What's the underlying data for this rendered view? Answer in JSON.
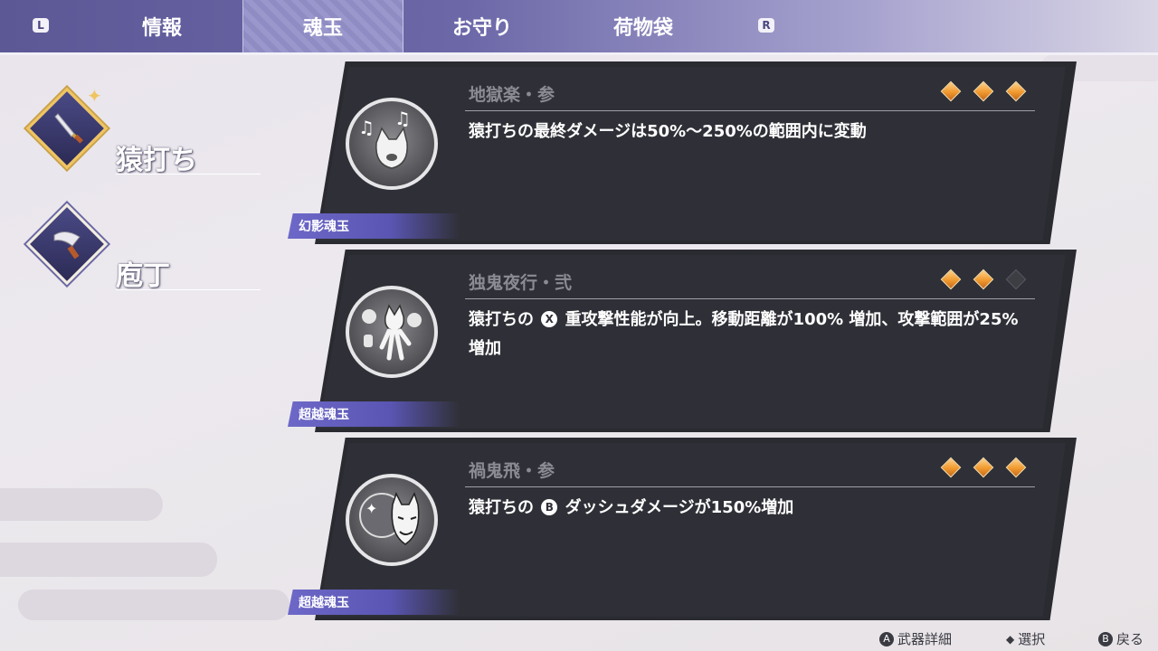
{
  "top_bar": {
    "left_key": "L",
    "right_key": "R",
    "tabs": [
      {
        "label": "情報",
        "active": false
      },
      {
        "label": "魂玉",
        "active": true
      },
      {
        "label": "お守り",
        "active": false
      },
      {
        "label": "荷物袋",
        "active": false
      }
    ]
  },
  "weapons": [
    {
      "name": "猿打ち",
      "icon": "katana-icon",
      "selected": true
    },
    {
      "name": "庖丁",
      "icon": "cleaver-icon",
      "selected": false
    }
  ],
  "soul_jades": [
    {
      "title": "地獄楽・参",
      "description": "猿打ちの最終ダメージは50%～250%の範囲内に変動",
      "type": "幻影魂玉",
      "rating": 3,
      "rating_max": 3,
      "icon": "music-cat-icon"
    },
    {
      "title": "独鬼夜行・弐",
      "description_before": "猿打ちの",
      "button": "X",
      "description_after": "重攻撃性能が向上。移動距離が100% 増加、攻撃範囲が25% 増加",
      "type": "超越魂玉",
      "rating": 2,
      "rating_max": 3,
      "icon": "lantern-cat-icon"
    },
    {
      "title": "禍鬼飛・参",
      "description_before": "猿打ちの",
      "button": "B",
      "description_after": "ダッシュダメージが150%増加",
      "type": "超越魂玉",
      "rating": 3,
      "rating_max": 3,
      "icon": "oni-mask-icon"
    }
  ],
  "footer": {
    "actions": [
      {
        "button": "A",
        "label": "武器詳細"
      },
      {
        "button": "◆",
        "label": "選択"
      },
      {
        "button": "B",
        "label": "戻る"
      }
    ]
  },
  "colors": {
    "accent": "#6d68c8",
    "gem": "#f09a2f",
    "card_bg": "#2f3037"
  }
}
